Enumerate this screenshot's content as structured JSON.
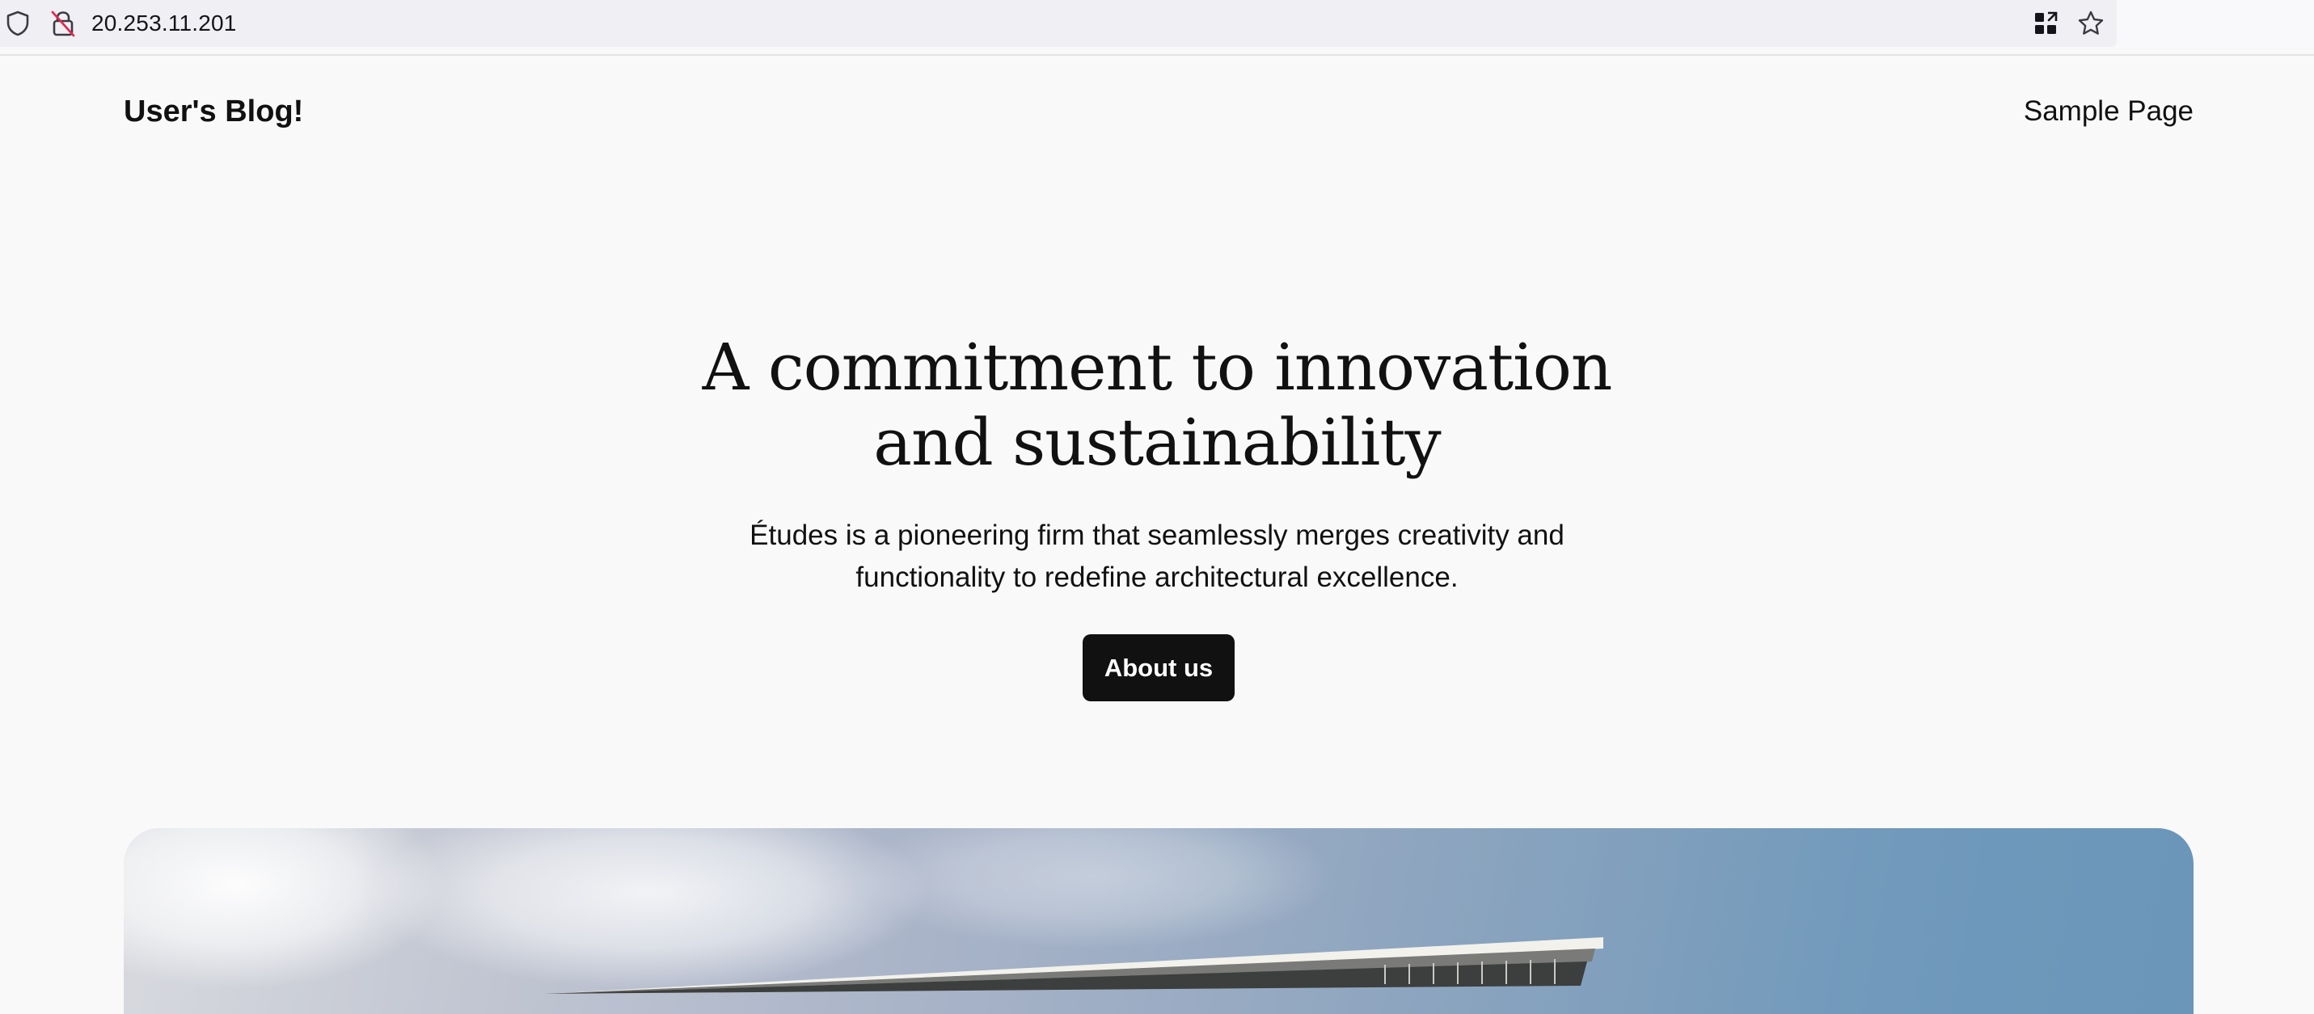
{
  "browser": {
    "url": "20.253.11.201",
    "icons": [
      "shield-icon",
      "insecure-lock-icon",
      "qr-code-icon",
      "bookmark-star-icon"
    ]
  },
  "header": {
    "site_title": "User's Blog!",
    "nav": [
      {
        "label": "Sample Page"
      }
    ]
  },
  "hero": {
    "heading_line1": "A commitment to innovation",
    "heading_line2": "and sustainability",
    "subtitle_line1": "Études is a pioneering firm that seamlessly merges creativity and",
    "subtitle_line2": "functionality to redefine architectural excellence.",
    "button_label": "About us"
  },
  "colors": {
    "page_background": "#f9f9f9",
    "text": "#111111",
    "button_background": "#111111",
    "button_text": "#ffffff",
    "urlbar_background": "#f0f0f4"
  }
}
